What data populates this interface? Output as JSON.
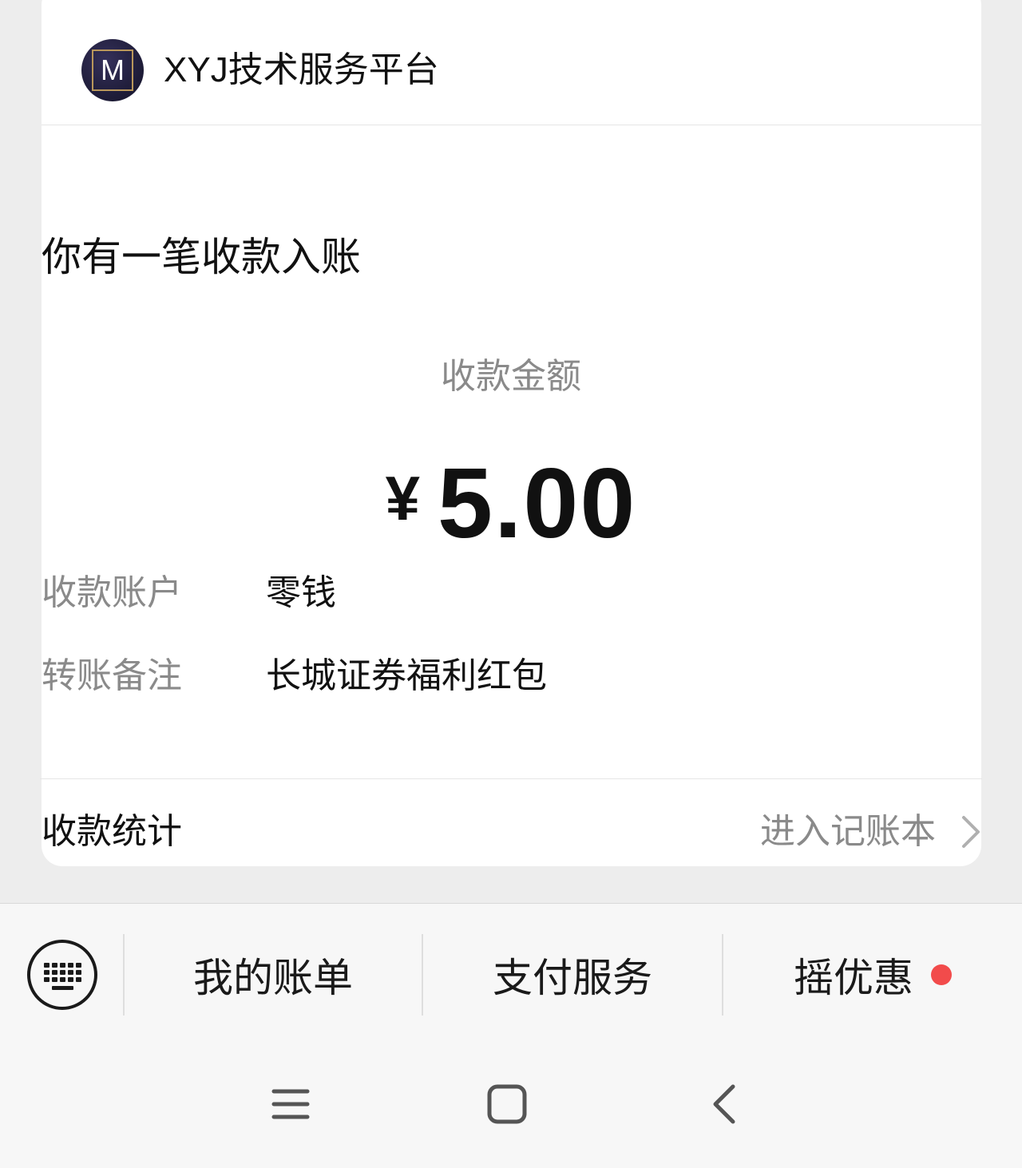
{
  "header": {
    "logo_letter": "M",
    "platform_name": "XYJ技术服务平台"
  },
  "notice": {
    "title": "你有一笔收款入账",
    "amount_label": "收款金额",
    "currency": "¥",
    "amount": "5.00"
  },
  "details": [
    {
      "label": "收款账户",
      "value": "零钱"
    },
    {
      "label": "转账备注",
      "value": "长城证券福利红包"
    }
  ],
  "stats": {
    "label": "收款统计",
    "link_text": "进入记账本"
  },
  "menu": {
    "items": [
      {
        "label": "我的账单"
      },
      {
        "label": "支付服务"
      },
      {
        "label": "摇优惠",
        "has_dot": true
      }
    ]
  },
  "icons": {
    "keyboard": "keyboard-icon",
    "chevron": "chevron-right-icon",
    "nav_menu": "menu-lines-icon",
    "nav_home": "home-square-icon",
    "nav_back": "back-chevron-icon"
  },
  "colors": {
    "background": "#ededed",
    "card": "#ffffff",
    "muted_text": "#8a8a8a",
    "red_dot": "#f24b4b",
    "logo_bg": "#1d1b36",
    "logo_frame": "#b9975b"
  }
}
